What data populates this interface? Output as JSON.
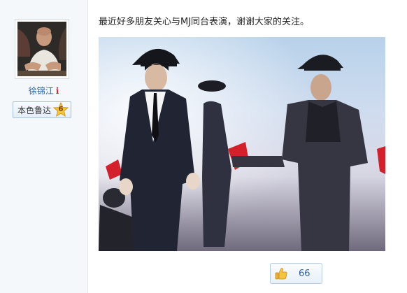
{
  "user": {
    "name": "徐锦江",
    "info_icon_char": "i",
    "badge_label": "本色鲁达",
    "badge_level": "6",
    "avatar_icon": "user-avatar"
  },
  "post": {
    "text": "最近好多朋友关心与MJ同台表演，谢谢大家的关注。",
    "image_icon": "stage-performance-photo"
  },
  "like": {
    "count": "66",
    "icon": "thumbs-up-icon"
  },
  "colors": {
    "link_blue": "#2b5fa8",
    "sidebar_bg": "#f5f8fb",
    "info_red": "#d8282b"
  }
}
